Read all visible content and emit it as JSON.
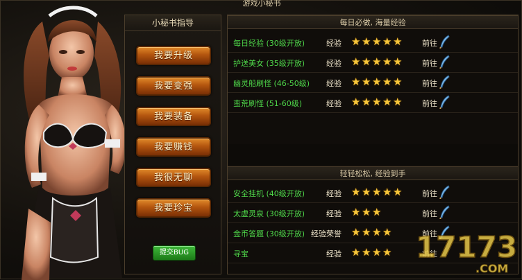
{
  "window": {
    "title": "游戏小秘书"
  },
  "left_panel": {
    "title": "小秘书指导",
    "buttons": [
      "我要升级",
      "我要变强",
      "我要装备",
      "我要赚钱",
      "我很无聊",
      "我要珍宝"
    ],
    "bug_button": "提交BUG"
  },
  "sections": [
    {
      "header": "每日必做, 海量经验",
      "tasks": [
        {
          "name": "每日经验 (30级开放)",
          "reward": "经验",
          "stars": 5,
          "goto": "前往"
        },
        {
          "name": "护送美女 (35级开放)",
          "reward": "经验",
          "stars": 5,
          "goto": "前往"
        },
        {
          "name": "幽灵船刷怪 (46-50级)",
          "reward": "经验",
          "stars": 5,
          "goto": "前往"
        },
        {
          "name": "蛮荒刷怪 (51-60级)",
          "reward": "经验",
          "stars": 5,
          "goto": "前往"
        }
      ]
    },
    {
      "header": "轻轻松松, 经验到手",
      "tasks": [
        {
          "name": "安全挂机 (40级开放)",
          "reward": "经验",
          "stars": 5,
          "goto": "前往"
        },
        {
          "name": "太虚灵泉 (30级开放)",
          "reward": "经验",
          "stars": 3,
          "goto": "前往"
        },
        {
          "name": "金币答题 (30级开放)",
          "reward": "经验荣誉",
          "stars": 4,
          "goto": "前往"
        },
        {
          "name": "寻宝",
          "reward": "经验",
          "stars": 4,
          "goto": "前往"
        }
      ]
    }
  ],
  "watermark": {
    "text": "17173",
    "domain": ".COM"
  },
  "icons": {
    "star": "star-icon",
    "quill": "quill-icon"
  },
  "colors": {
    "task_name": "#4fd84a",
    "star": "#f7c63a",
    "button": "#b4560f"
  }
}
